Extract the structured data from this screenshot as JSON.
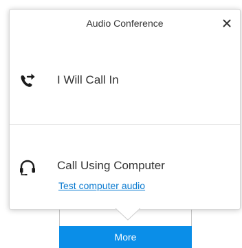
{
  "popup": {
    "title": "Audio Conference",
    "close_icon": "close-icon",
    "options": [
      {
        "label": "I Will Call In",
        "icon": "phone-forward-icon"
      },
      {
        "label": "Call Using Computer",
        "icon": "headset-icon",
        "link": "Test computer audio"
      }
    ]
  },
  "toolbar": {
    "more_label": "More"
  },
  "colors": {
    "accent": "#0a8ee8",
    "link": "#0a7ad0",
    "text": "#333333",
    "icon": "#1a1a1a"
  }
}
